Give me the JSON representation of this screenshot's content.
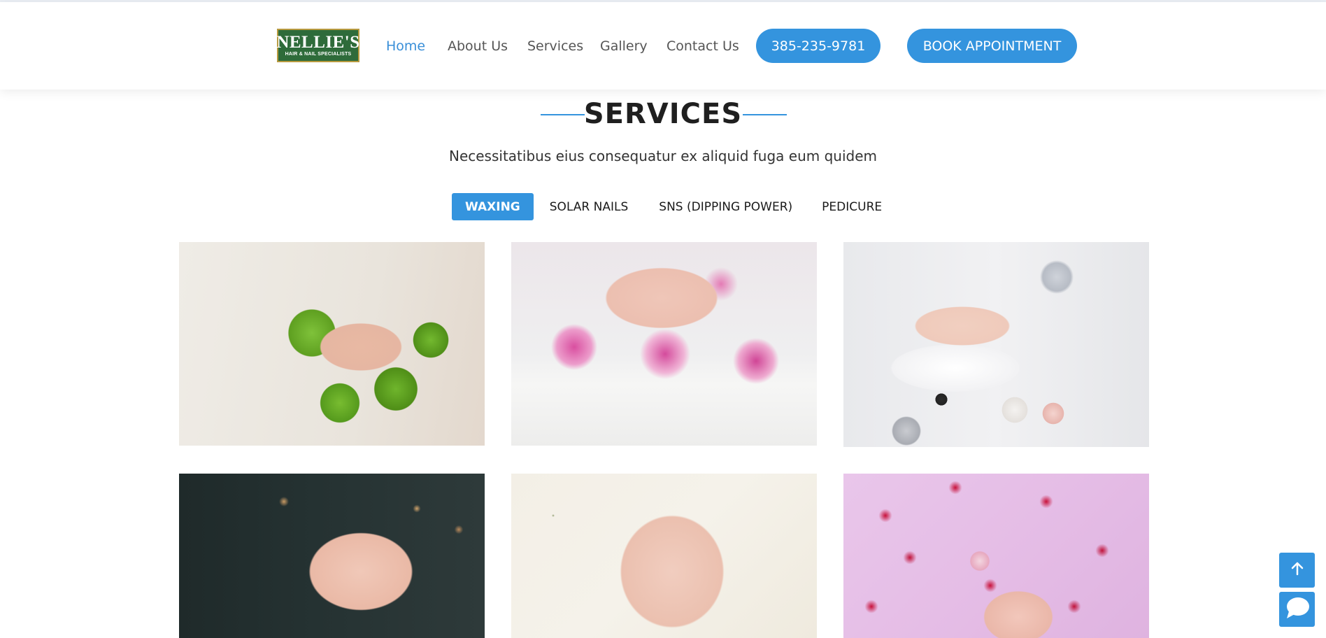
{
  "brand": {
    "logo_main": "NELLIE'S",
    "logo_sub": "HAIR & NAIL SPECIALISTS"
  },
  "nav": {
    "items": [
      {
        "label": "Home",
        "active": true
      },
      {
        "label": "About Us",
        "active": false
      },
      {
        "label": "Services",
        "active": false
      },
      {
        "label": "Gallery",
        "active": false
      },
      {
        "label": "Contact Us",
        "active": false
      }
    ],
    "phone_label": "385-235-9781",
    "book_label": "BOOK APPOINTMENT"
  },
  "services": {
    "title": "SERVICES",
    "subtitle": "Necessitatibus eius consequatur ex aliquid fuga eum quidem",
    "filters": [
      {
        "label": "WAXING",
        "active": true
      },
      {
        "label": "SOLAR NAILS",
        "active": false
      },
      {
        "label": "SNS (DIPPING POWER)",
        "active": false
      },
      {
        "label": "PEDICURE",
        "active": false
      }
    ]
  },
  "icons": {
    "scroll_top": "arrow-up-icon",
    "chat": "chat-bubble-icon"
  },
  "colors": {
    "accent": "#3494de",
    "nav_active": "#3a8fd8",
    "text": "#1f1f1f"
  }
}
